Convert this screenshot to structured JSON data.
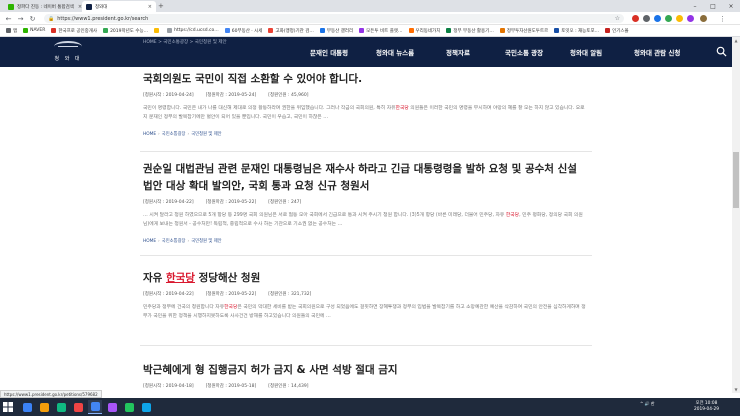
{
  "browser": {
    "tabs": [
      {
        "label": "정파다 진동 : 네이버 통합검색",
        "active": false,
        "favicon_color": "#2db400"
      },
      {
        "label": "청와대",
        "active": true,
        "favicon_color": "#0f2043"
      }
    ],
    "address": "https://www1.president.go.kr/search",
    "bookmarks": [
      {
        "label": "앱",
        "color": "#5f6368"
      },
      {
        "label": "NAVER",
        "color": "#2db400"
      },
      {
        "label": "한국프로 공인중개사",
        "color": "#d93025"
      },
      {
        "label": "2019학년도 수능…",
        "color": "#34a853"
      },
      {
        "label": "",
        "color": "#fbbc05"
      },
      {
        "label": "https://cd.ucsd.co…",
        "color": "#9aa0a6"
      },
      {
        "label": "60부동산 · 시세",
        "color": "#4285f4"
      },
      {
        "label": "고화(맹정)기관 검…",
        "color": "#ea4335"
      },
      {
        "label": "부동산 갤러리",
        "color": "#1a73e8"
      },
      {
        "label": "모든투 비트 플렛…",
        "color": "#9334e6"
      },
      {
        "label": "우리동네가치",
        "color": "#ff6d00"
      },
      {
        "label": "정부 부동산 활용기…",
        "color": "#0b8043"
      },
      {
        "label": "정부투자산원도투트르",
        "color": "#e37400"
      },
      {
        "label": "토잇오 : 재능토포…",
        "color": "#174ea6"
      },
      {
        "label": "인기스몰",
        "color": "#c5221f"
      }
    ]
  },
  "site": {
    "logo_text": "청 와 대",
    "top_breadcrumb": "HOME > 국민소통광장 > 국민청원 및 제안",
    "nav": [
      "문재인 대통령",
      "청와대 뉴스룸",
      "정책자료",
      "국민소통 광장",
      "청와대 알림",
      "청와대 관람 신청"
    ]
  },
  "posts": [
    {
      "title_parts": [
        {
          "text": "국회의원도 국민이 직접 소환할 수 있어야 합니다.",
          "hl": false
        }
      ],
      "start_label": "[청원시작 : ",
      "start": "2019-04-24",
      "end_label": "[청원마감 : ",
      "end": "2019-05-24",
      "count_label": "[청원인원 : ",
      "count": "45,960",
      "excerpt_parts": [
        {
          "text": "국민이 명령합니다. 국민은 내가 나를 대신해 제대로 의정 활동하라며 권한을 위임했습니다. 그러나 작금의 국회의원, 특히 자유",
          "hl": false
        },
        {
          "text": "한국당",
          "hl": true
        },
        {
          "text": " 의원들은 이러한 국민의 명령을 무시하며 야망의 혜를 잘 모는 하지 않고 있습니다. 오로지 문재인 정부의 발목잡기에만 혈안이 되어 있을 뿐입니다. 국민이 우습고, 국민이 하찮은 …",
          "hl": false
        }
      ]
    },
    {
      "title_parts": [
        {
          "text": "권순일 대법관님 관련 문재인 대통령님은 재수사 하라고 긴급 대통령령을 발하 요청 및 공수처 신설 법안 대상 확대 발의안, 국회 통과 요청 신규 청원서",
          "hl": false
        }
      ],
      "start_label": "[청원시작 : ",
      "start": "2019-04-22",
      "end_label": "[청원마감 : ",
      "end": "2019-05-22",
      "count_label": "[청원인원 : ",
      "count": "247",
      "excerpt_parts": [
        {
          "text": "… 시켜 달라고 청원 하였으므로 5개 항당 등 299명 국회 의원님은 서로 협동 모아 국회에서 긴급으로 통과 시켜 주시기 청원 합니다. (3)5개 항당 (바른 미래당, 더불어 민주당, 자유 ",
          "hl": false
        },
        {
          "text": "한국당",
          "hl": true
        },
        {
          "text": ", 민주 평화당, 정의당 국회 의원님)에게 보내는 청원서 - 공수처만! 독립적, 중립적으로 수사 하는 기관으로 기소권 없는 공수처는 …",
          "hl": false
        }
      ]
    },
    {
      "title_parts": [
        {
          "text": "자유 ",
          "hl": false
        },
        {
          "text": "한국당",
          "hl": true
        },
        {
          "text": " 정당해산 청원",
          "hl": false
        }
      ],
      "start_label": "[청원시작 : ",
      "start": "2019-04-22",
      "end_label": "[청원마감 : ",
      "end": "2019-05-22",
      "count_label": "[청원인원 : ",
      "count": "321,732",
      "excerpt_parts": [
        {
          "text": "민주당과 정부에 건국의 청원합니다 자유",
          "hl": false
        },
        {
          "text": "한국당",
          "hl": true
        },
        {
          "text": "은 국민의 막대한 세비를 받는 국회의원으로 구성 되었음에도 걸핏하면 장혜투쟁과 정부의 입법을 발목잡기를 하고 소망예관한 예산을 삭감하여 국민의 안전을 심각하게하며 정부가 국민을 위한 정책을 시행하지못하도록 사사건건 방해를 하고있습니다 의원들의 국민에 …",
          "hl": false
        }
      ]
    },
    {
      "title_parts": [
        {
          "text": "박근혜에게 형 집행금지 허가 금지 & 사면 석방 절대 금지",
          "hl": false
        }
      ],
      "start_label": "[청원시작 : ",
      "start": "2019-04-18",
      "end_label": "[청원마감 : ",
      "end": "2019-05-18",
      "count_label": "[청원인원 : ",
      "count": "14,439",
      "excerpt_parts": []
    }
  ],
  "crumb": {
    "home": "HOME",
    "section": "국민소통광장",
    "page": "국민청원 및 제안"
  },
  "status_url": "https://www1.president.go.kr/petitions/579682",
  "taskbar": {
    "tray_text": "^ 🔊 한",
    "time": "오전 10:08",
    "date": "2019-04-29",
    "apps": [
      "#3b82f6",
      "#f59e0b",
      "#10b981",
      "#ef4444",
      "#4285f4",
      "#a855f7",
      "#22c55e",
      "#0ea5e9"
    ]
  },
  "colors": {
    "header": "#0f2043",
    "highlight": "#d9182e",
    "crumb": "#2b4d8c"
  }
}
